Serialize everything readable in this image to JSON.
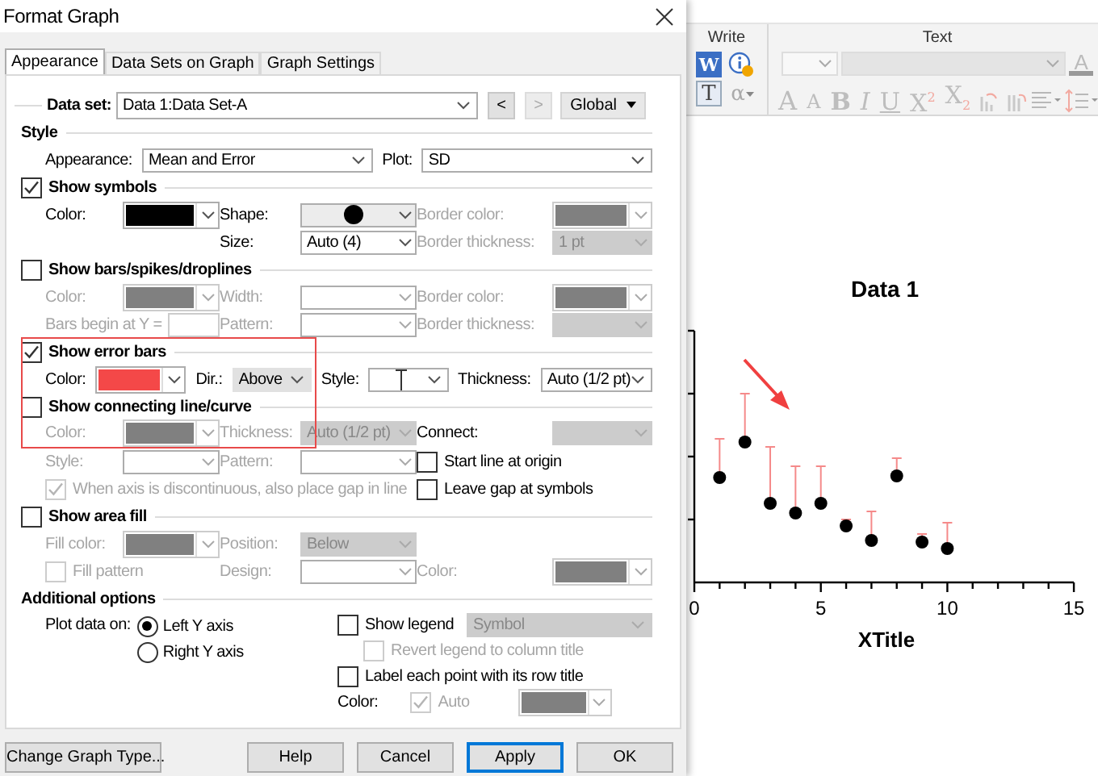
{
  "window": {
    "title": "Format Graph"
  },
  "tabs": [
    {
      "label": "Appearance",
      "selected": true
    },
    {
      "label": "Data Sets on Graph",
      "selected": false
    },
    {
      "label": "Graph Settings",
      "selected": false
    }
  ],
  "data_set": {
    "label": "Data set:",
    "value": "Data 1:Data Set-A",
    "prev": {
      "label": "<",
      "disabled": false
    },
    "next": {
      "label": ">",
      "disabled": true
    },
    "scope": "Global"
  },
  "style": {
    "title": "Style",
    "items": [
      {
        "kind": "label",
        "text": "Appearance:",
        "disabled": false
      },
      {
        "kind": "combo",
        "value": "Mean and Error",
        "disabled": false
      },
      {
        "kind": "label",
        "text": "Plot:",
        "disabled": false
      },
      {
        "kind": "combo",
        "value": "SD",
        "disabled": false
      }
    ]
  },
  "sections": [
    {
      "title": "Show symbols",
      "checked": true,
      "rows": [
        {
          "kind": "grid",
          "items": [
            {
              "kind": "label",
              "text": "Color:",
              "disabled": false
            },
            {
              "kind": "swatch",
              "color": "#000000",
              "disabled": false
            },
            {
              "kind": "label",
              "text": "Shape:",
              "disabled": false
            },
            {
              "kind": "shape-combo",
              "disabled": false
            },
            {
              "kind": "label",
              "text": "Border color:",
              "disabled": true
            },
            {
              "kind": "swatch",
              "color": "#808080",
              "disabled": true
            }
          ]
        },
        {
          "kind": "grid",
          "items": [
            {
              "kind": "gap"
            },
            {
              "kind": "gap"
            },
            {
              "kind": "label",
              "text": "Size:",
              "disabled": false
            },
            {
              "kind": "combo",
              "value": "Auto (4)",
              "disabled": false
            },
            {
              "kind": "label",
              "text": "Border thickness:",
              "disabled": true
            },
            {
              "kind": "button-combo",
              "value": "1 pt",
              "disabled": true
            }
          ]
        }
      ]
    },
    {
      "title": "Show bars/spikes/droplines",
      "checked": false,
      "rows": [
        {
          "kind": "grid",
          "items": [
            {
              "kind": "label",
              "text": "Color:",
              "disabled": true
            },
            {
              "kind": "swatch",
              "color": "#808080",
              "disabled": true
            },
            {
              "kind": "label",
              "text": "Width:",
              "disabled": true
            },
            {
              "kind": "combo",
              "disabled": true
            },
            {
              "kind": "label",
              "text": "Border color:",
              "disabled": true
            },
            {
              "kind": "swatch",
              "color": "#808080",
              "disabled": true
            }
          ]
        },
        {
          "kind": "grid",
          "items": [
            {
              "kind": "labeled-input",
              "label": "Bars begin at Y =",
              "disabled": true
            },
            {
              "kind": "label",
              "text": "Pattern:",
              "disabled": true
            },
            {
              "kind": "combo",
              "disabled": true
            },
            {
              "kind": "label",
              "text": "Border thickness:",
              "disabled": true
            },
            {
              "kind": "button-combo",
              "disabled": true
            }
          ]
        }
      ]
    },
    {
      "title": "Show error bars",
      "checked": true,
      "rows": [
        {
          "kind": "inline",
          "items": [
            {
              "kind": "label",
              "text": "Color:",
              "disabled": false
            },
            {
              "kind": "swatch",
              "color": "#f44848",
              "disabled": false
            },
            {
              "kind": "label",
              "text": "Dir.:",
              "disabled": false
            },
            {
              "kind": "button-combo",
              "value": "Above",
              "disabled": false
            },
            {
              "kind": "label",
              "text": "Style:",
              "disabled": false
            },
            {
              "kind": "cap-combo",
              "disabled": false
            },
            {
              "kind": "label",
              "text": "Thickness:",
              "disabled": false
            },
            {
              "kind": "combo",
              "value": "Auto (1/2 pt)",
              "disabled": false
            }
          ]
        }
      ]
    },
    {
      "title": "Show connecting line/curve",
      "checked": false,
      "rows": [
        {
          "kind": "grid",
          "items": [
            {
              "kind": "label",
              "text": "Color:",
              "disabled": true
            },
            {
              "kind": "swatch",
              "color": "#808080",
              "disabled": true
            },
            {
              "kind": "label",
              "text": "Thickness:",
              "disabled": true
            },
            {
              "kind": "button-combo",
              "value": "Auto (1/2 pt)",
              "disabled": true
            },
            {
              "kind": "label",
              "text": "Connect:",
              "disabled": false
            },
            {
              "kind": "button-combo",
              "disabled": true
            }
          ]
        },
        {
          "kind": "grid",
          "items": [
            {
              "kind": "label",
              "text": "Style:",
              "disabled": true
            },
            {
              "kind": "combo",
              "disabled": true
            },
            {
              "kind": "label",
              "text": "Pattern:",
              "disabled": true
            },
            {
              "kind": "combo",
              "disabled": true
            },
            {
              "kind": "check",
              "label": "Start line at origin",
              "checked": false,
              "disabled": false
            }
          ]
        },
        {
          "kind": "grid",
          "items": [
            {
              "kind": "check",
              "label": "When axis is discontinuous, also place gap in line",
              "checked": true,
              "disabled": true
            },
            {
              "kind": "check",
              "label": "Leave gap at symbols",
              "checked": false,
              "disabled": false
            }
          ]
        }
      ]
    },
    {
      "title": "Show area fill",
      "checked": false,
      "rows": [
        {
          "kind": "grid",
          "items": [
            {
              "kind": "label",
              "text": "Fill color:",
              "disabled": true
            },
            {
              "kind": "swatch",
              "color": "#808080",
              "disabled": true
            },
            {
              "kind": "label",
              "text": "Position:",
              "disabled": true
            },
            {
              "kind": "button-combo",
              "value": "Below",
              "disabled": true
            }
          ]
        },
        {
          "kind": "grid",
          "items": [
            {
              "kind": "check",
              "label": "Fill pattern",
              "checked": false,
              "disabled": true
            },
            {
              "kind": "label",
              "text": "Design:",
              "disabled": true
            },
            {
              "kind": "combo",
              "disabled": true
            },
            {
              "kind": "label",
              "text": "Color:",
              "disabled": true
            },
            {
              "kind": "swatch",
              "color": "#808080",
              "disabled": true
            }
          ]
        }
      ]
    }
  ],
  "additional": {
    "title": "Additional options",
    "plot_label": "Plot data on:",
    "axes": [
      {
        "label": "Left Y axis",
        "selected": true
      },
      {
        "label": "Right  Y axis",
        "selected": false
      }
    ],
    "show_legend": {
      "label": "Show legend",
      "checked": false,
      "disabled": false,
      "value": "Symbol"
    },
    "revert_legend": {
      "label": "Revert legend to column title",
      "checked": false,
      "disabled": true
    },
    "label_points": {
      "label": "Label each point with its row title",
      "checked": false,
      "disabled": false
    },
    "color": {
      "label": "Color:",
      "auto": {
        "label": "Auto",
        "checked": true,
        "disabled": true
      },
      "swatch": {
        "color": "#808080",
        "disabled": true
      }
    }
  },
  "buttons": [
    {
      "label": "Change Graph Type...",
      "default": false
    },
    {
      "label": "Help",
      "default": false
    },
    {
      "label": "Cancel",
      "default": false
    },
    {
      "label": "Apply",
      "default": true
    },
    {
      "label": "OK",
      "default": false
    }
  ],
  "ribbon": {
    "write": {
      "title": "Write",
      "tools": [
        {
          "glyph": "W",
          "kind": "filled"
        },
        {
          "glyph": "T",
          "kind": "boxed"
        },
        {
          "glyph": "α",
          "kind": "menu"
        }
      ]
    },
    "text": {
      "title": "Text",
      "font_color": "A",
      "tools": [
        {
          "glyph": "A",
          "kind": "grow"
        },
        {
          "glyph": "A",
          "kind": "shrink"
        },
        {
          "glyph": "B",
          "kind": "bold"
        },
        {
          "glyph": "I",
          "kind": "italic"
        },
        {
          "glyph": "U",
          "kind": "underline"
        },
        {
          "glyph": "X$^{2}$",
          "kind": "plain"
        },
        {
          "glyph": "X$_{2}$",
          "kind": "plain"
        }
      ]
    }
  },
  "graph": {
    "title": "Data 1",
    "xlabel": "XTitle",
    "xticks": [
      "0",
      "5",
      "10",
      "15"
    ]
  }
}
